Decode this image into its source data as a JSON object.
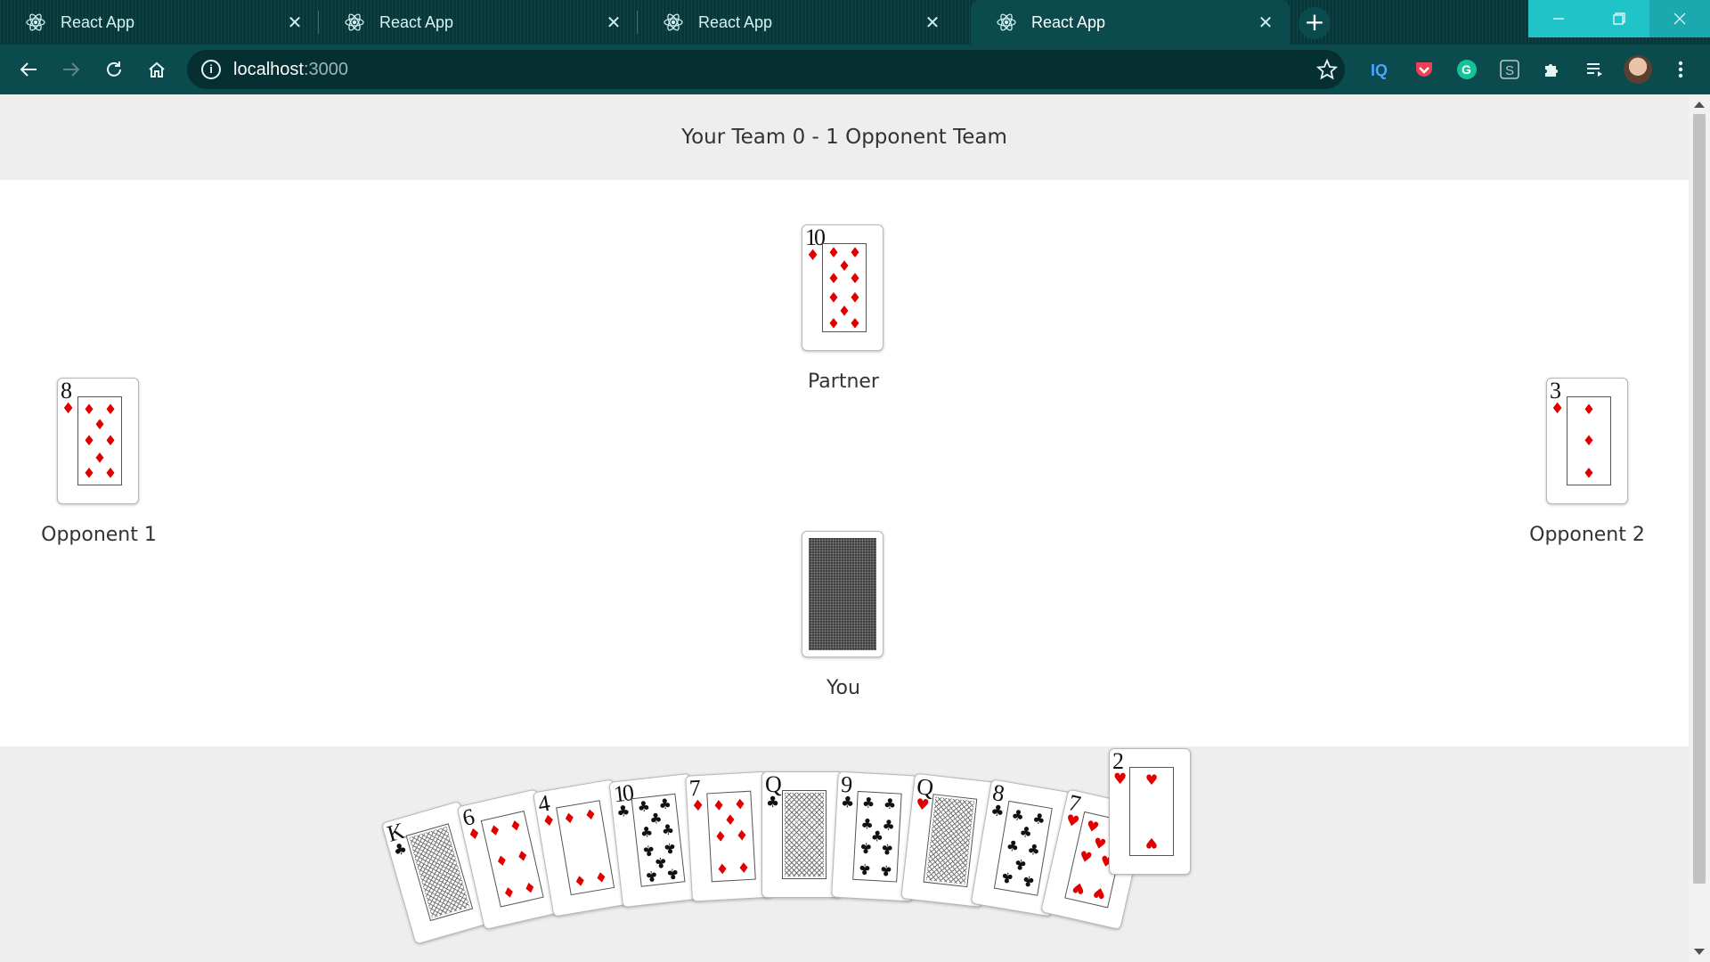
{
  "browser": {
    "tabs": [
      {
        "title": "React App",
        "active": false
      },
      {
        "title": "React App",
        "active": false
      },
      {
        "title": "React App",
        "active": false
      },
      {
        "title": "React App",
        "active": true
      }
    ],
    "url_host": "localhost",
    "url_port": ":3000"
  },
  "game": {
    "score": "Your Team 0 - 1 Opponent Team",
    "players": {
      "partner": {
        "label": "Partner",
        "card": {
          "rank": "10",
          "suit": "diamonds"
        }
      },
      "opponent1": {
        "label": "Opponent 1",
        "card": {
          "rank": "8",
          "suit": "diamonds"
        }
      },
      "opponent2": {
        "label": "Opponent 2",
        "card": {
          "rank": "3",
          "suit": "diamonds"
        }
      },
      "you": {
        "label": "You",
        "card": "face-down"
      }
    },
    "hand": [
      {
        "rank": "K",
        "suit": "clubs"
      },
      {
        "rank": "6",
        "suit": "diamonds"
      },
      {
        "rank": "4",
        "suit": "diamonds"
      },
      {
        "rank": "10",
        "suit": "clubs"
      },
      {
        "rank": "7",
        "suit": "diamonds"
      },
      {
        "rank": "Q",
        "suit": "clubs"
      },
      {
        "rank": "9",
        "suit": "clubs"
      },
      {
        "rank": "Q",
        "suit": "hearts"
      },
      {
        "rank": "8",
        "suit": "clubs"
      },
      {
        "rank": "7",
        "suit": "hearts"
      },
      {
        "rank": "2",
        "suit": "hearts",
        "selected": true
      }
    ]
  },
  "colors": {
    "red_suit": "#e00000",
    "black_suit": "#111111",
    "chrome": "#0b4a4d"
  }
}
